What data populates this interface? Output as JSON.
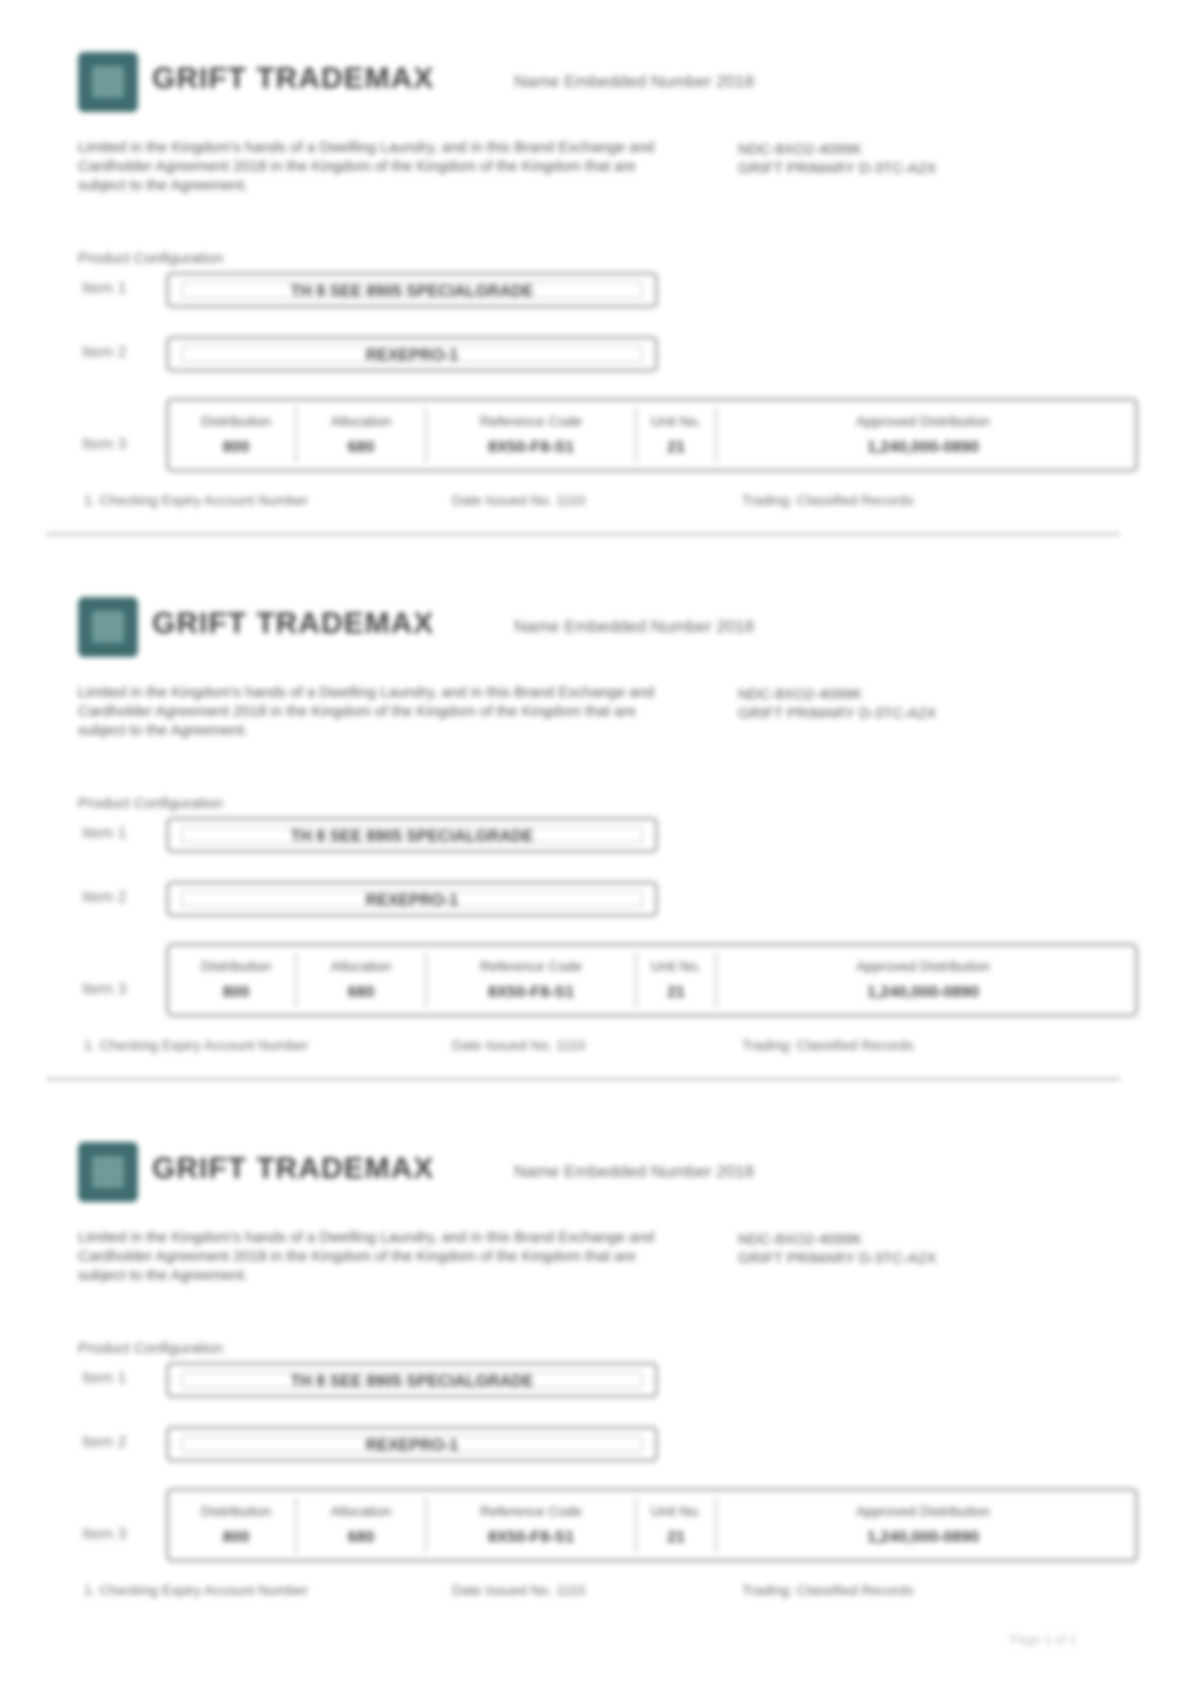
{
  "colors": {
    "logo": "#3f6d6f",
    "accent": "#6e9a9b",
    "border": "#aaaaaa"
  },
  "brand": "GRIFT TRADEMAX",
  "header_right": "Name Embedded Number 2018",
  "description": "Limited in the Kingdom's hands of a Dwelling Laundry, and in this Brand Exchange and Cardholder Agreement 2018 in the Kingdom of the Kingdom of the Kingdom that are subject to the Agreement.",
  "right_info": [
    "NDC-8XO2-4099K",
    "GRIFT PRIMARY D-3TC-A2X"
  ],
  "prompt_label": "Product Configuration",
  "rows": {
    "row1_label": "Item 1",
    "row1_value": "TH 8 SEE 8905 SPECIALGRADE",
    "row2_label": "Item 2",
    "row2_value": "REXEPRO-1",
    "row3_label": "Item 3"
  },
  "grid": [
    {
      "head": "Distribution",
      "value": "800"
    },
    {
      "head": "Allocation",
      "value": "680"
    },
    {
      "head": "Reference Code",
      "value": "8X50-F8-S1"
    },
    {
      "head": "Unit No.",
      "value": "21"
    },
    {
      "head": "Approved Distribution",
      "value": "1,240,000-0890"
    }
  ],
  "footer": [
    "1. Checking Expiry Account Number",
    "Date Issued No. 1110",
    "Trading: Classified Records"
  ],
  "page_number": "Page 1 of 1"
}
